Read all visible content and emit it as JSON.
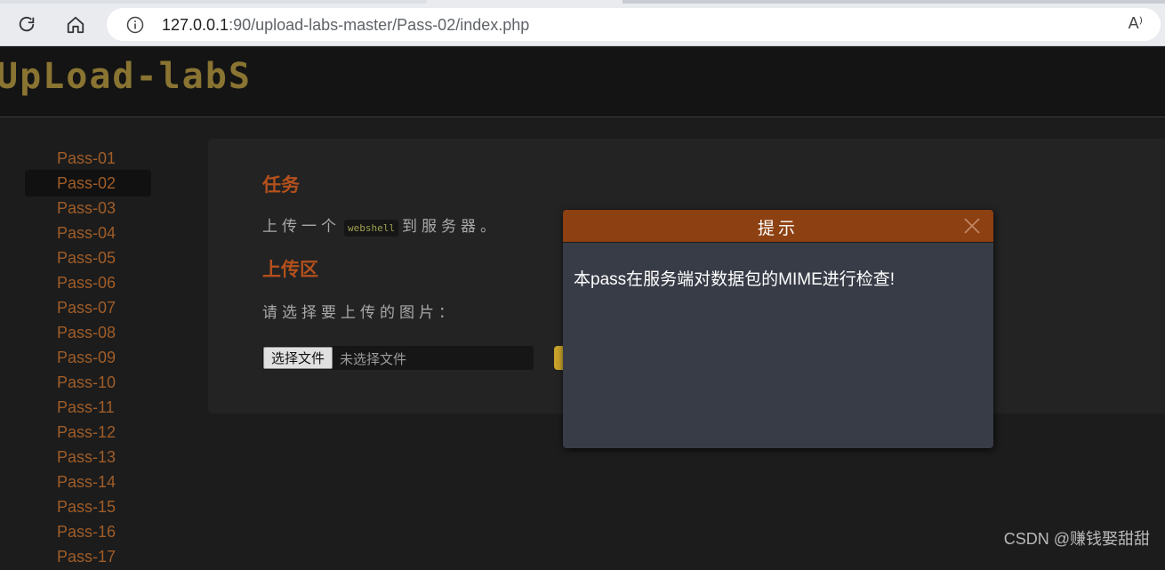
{
  "browser": {
    "url_host": "127.0.0.1",
    "url_rest": ":90/upload-labs-master/Pass-02/index.php",
    "read_aloud": "A⁾"
  },
  "site": {
    "logo_text": "UpLoad-labS"
  },
  "sidebar": {
    "items": [
      {
        "label": "Pass-01"
      },
      {
        "label": "Pass-02"
      },
      {
        "label": "Pass-03"
      },
      {
        "label": "Pass-04"
      },
      {
        "label": "Pass-05"
      },
      {
        "label": "Pass-06"
      },
      {
        "label": "Pass-07"
      },
      {
        "label": "Pass-08"
      },
      {
        "label": "Pass-09"
      },
      {
        "label": "Pass-10"
      },
      {
        "label": "Pass-11"
      },
      {
        "label": "Pass-12"
      },
      {
        "label": "Pass-13"
      },
      {
        "label": "Pass-14"
      },
      {
        "label": "Pass-15"
      },
      {
        "label": "Pass-16"
      },
      {
        "label": "Pass-17"
      }
    ],
    "active_label": "Pass-02"
  },
  "main": {
    "task_heading": "任务",
    "task_before": "上传一个",
    "task_code": "webshell",
    "task_after": "到服务器。",
    "upload_heading": "上传区",
    "choose_prompt": "请选择要上传的图片：",
    "file_button": "选择文件",
    "file_status": "未选择文件"
  },
  "modal": {
    "title": "提示",
    "message": "本pass在服务端对数据包的MIME进行检查!"
  },
  "watermark": "CSDN @赚钱娶甜甜",
  "colors": {
    "accent_orange": "#b4501c",
    "modal_header": "#8d4011",
    "logo": "#8a7432",
    "upload_button": "#c8a32b"
  }
}
